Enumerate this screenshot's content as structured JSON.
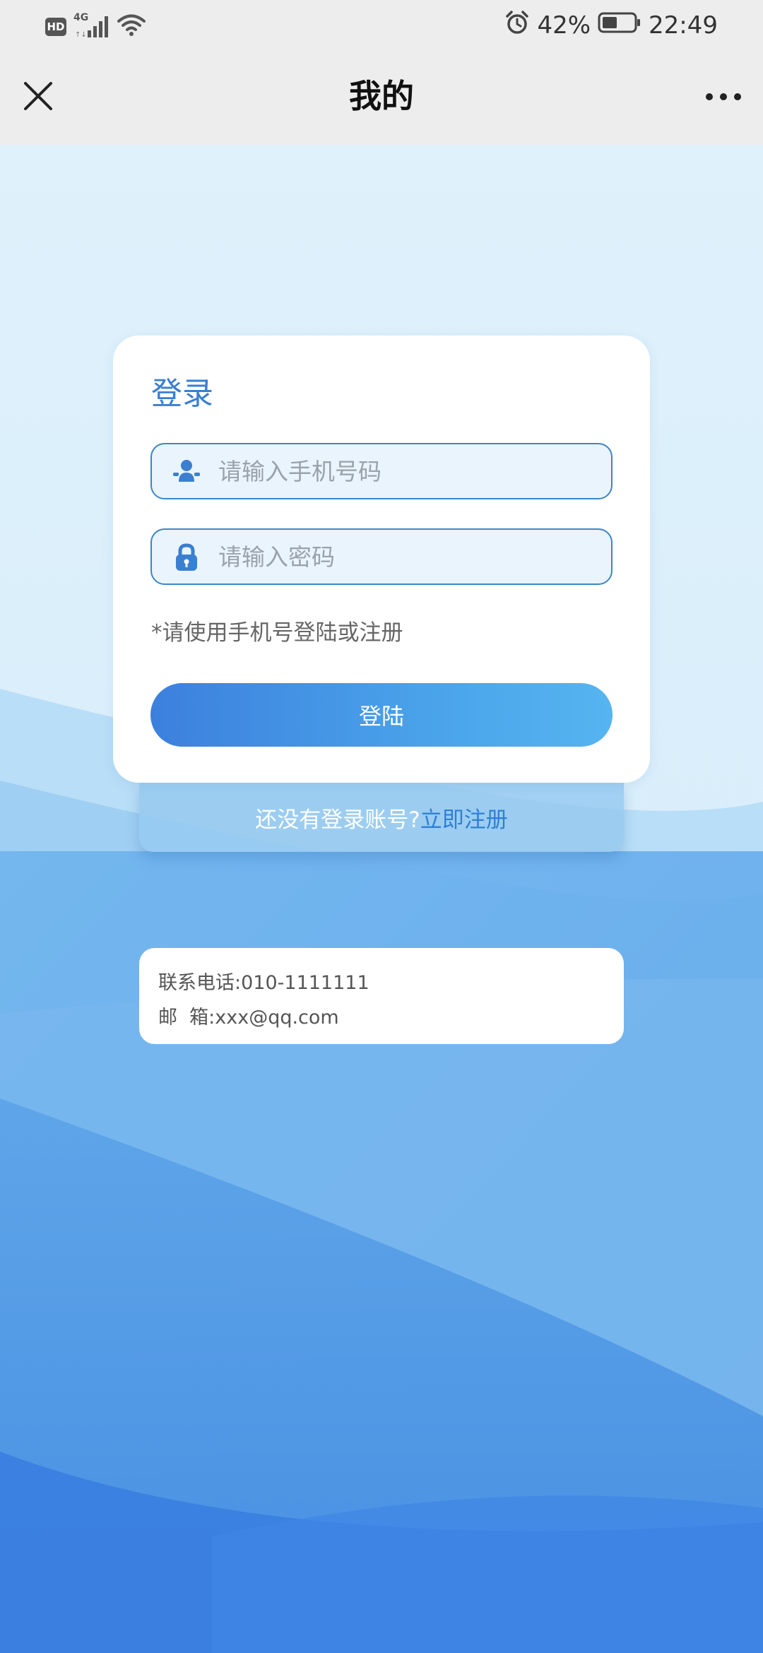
{
  "status_bar": {
    "hd": "HD",
    "signal_label": "4G",
    "battery": "42%",
    "time": "22:49"
  },
  "header": {
    "title": "我的"
  },
  "login": {
    "title": "登录",
    "phone_placeholder": "请输入手机号码",
    "password_placeholder": "请输入密码",
    "hint": "*请使用手机号登陆或注册",
    "button": "登陆"
  },
  "register": {
    "question": "还没有登录账号?",
    "link": "立即注册"
  },
  "contact": {
    "phone_label": "联系电话:",
    "phone_value": "010-1111111",
    "email_label": "邮  箱:",
    "email_value": "xxx@qq.com"
  },
  "colors": {
    "accent": "#3a7fd0",
    "button_start": "#3c80dd",
    "button_end": "#56b4f0"
  }
}
